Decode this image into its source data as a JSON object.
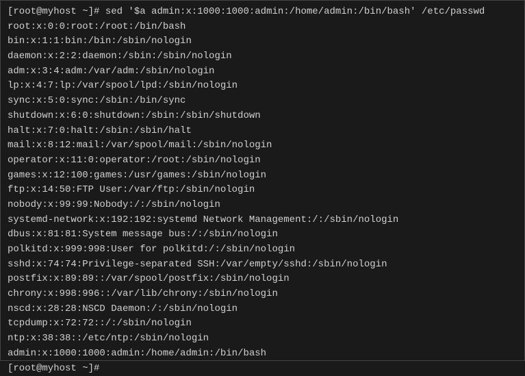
{
  "prompt1": "[root@myhost ~]# ",
  "command": "sed '$a admin:x:1000:1000:admin:/home/admin:/bin/bash' /etc/passwd",
  "output": [
    "root:x:0:0:root:/root:/bin/bash",
    "bin:x:1:1:bin:/bin:/sbin/nologin",
    "daemon:x:2:2:daemon:/sbin:/sbin/nologin",
    "adm:x:3:4:adm:/var/adm:/sbin/nologin",
    "lp:x:4:7:lp:/var/spool/lpd:/sbin/nologin",
    "sync:x:5:0:sync:/sbin:/bin/sync",
    "shutdown:x:6:0:shutdown:/sbin:/sbin/shutdown",
    "halt:x:7:0:halt:/sbin:/sbin/halt",
    "mail:x:8:12:mail:/var/spool/mail:/sbin/nologin",
    "operator:x:11:0:operator:/root:/sbin/nologin",
    "games:x:12:100:games:/usr/games:/sbin/nologin",
    "ftp:x:14:50:FTP User:/var/ftp:/sbin/nologin",
    "nobody:x:99:99:Nobody:/:/sbin/nologin",
    "systemd-network:x:192:192:systemd Network Management:/:/sbin/nologin",
    "dbus:x:81:81:System message bus:/:/sbin/nologin",
    "polkitd:x:999:998:User for polkitd:/:/sbin/nologin",
    "sshd:x:74:74:Privilege-separated SSH:/var/empty/sshd:/sbin/nologin",
    "postfix:x:89:89::/var/spool/postfix:/sbin/nologin",
    "chrony:x:998:996::/var/lib/chrony:/sbin/nologin",
    "nscd:x:28:28:NSCD Daemon:/:/sbin/nologin",
    "tcpdump:x:72:72::/:/sbin/nologin",
    "ntp:x:38:38::/etc/ntp:/sbin/nologin",
    "admin:x:1000:1000:admin:/home/admin:/bin/bash"
  ],
  "prompt2": "[root@myhost ~]#"
}
